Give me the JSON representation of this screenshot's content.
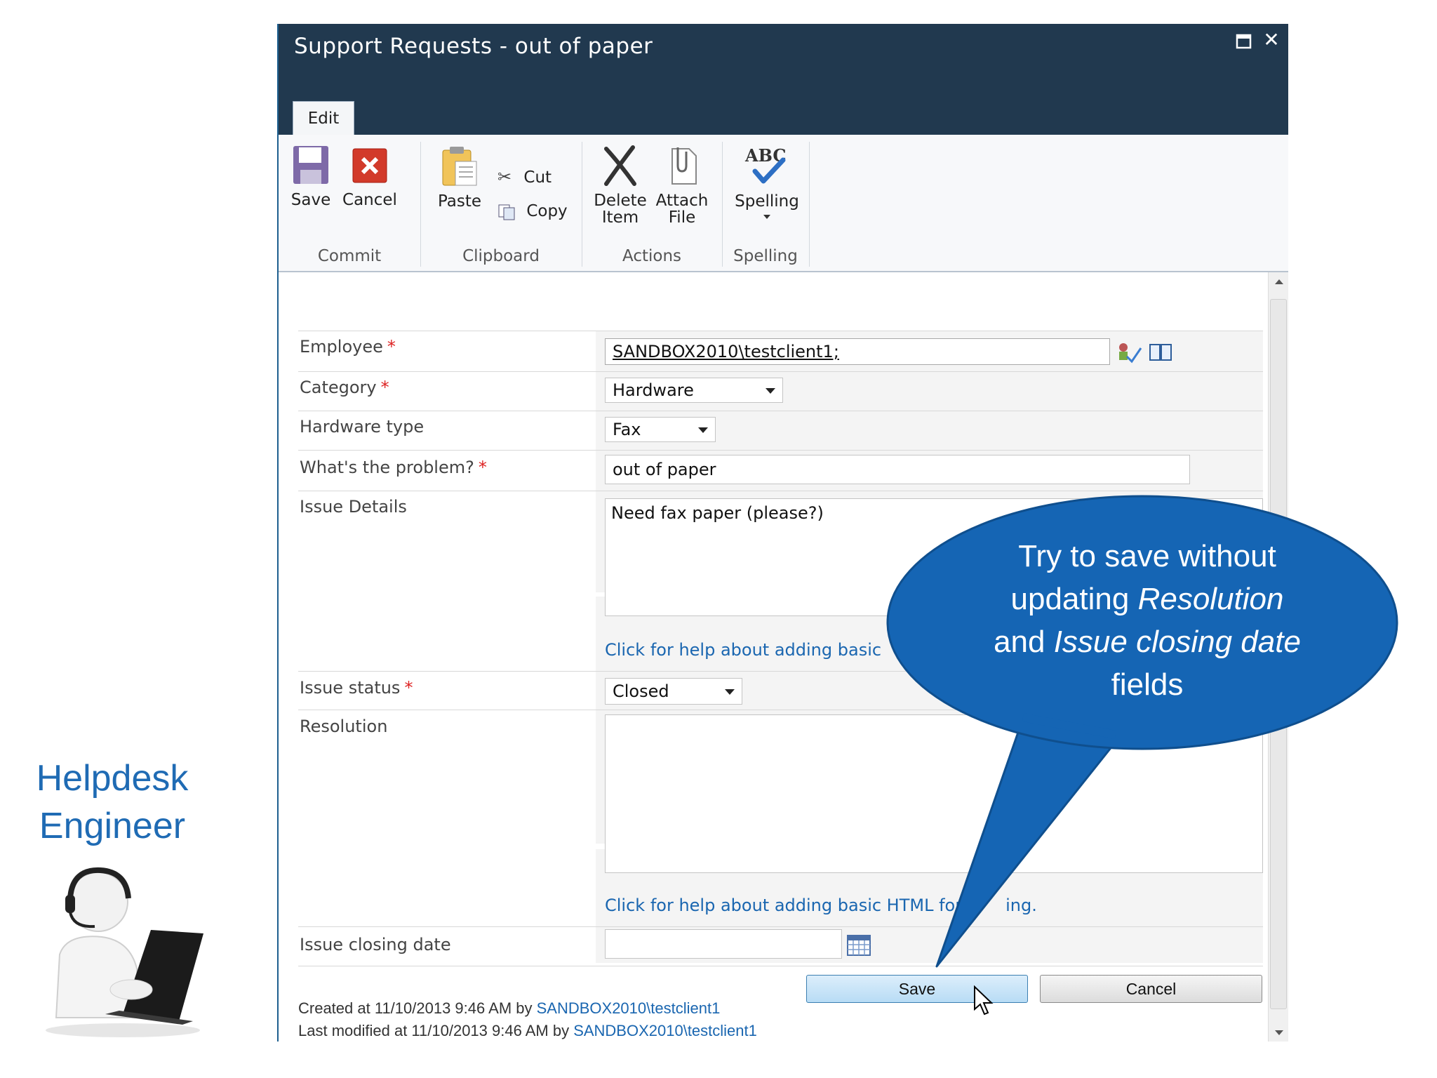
{
  "persona": {
    "title_line1": "Helpdesk",
    "title_line2": "Engineer"
  },
  "dialog": {
    "title": "Support Requests - out of paper",
    "tab": "Edit",
    "ribbon": {
      "save": "Save",
      "cancel": "Cancel",
      "paste": "Paste",
      "cut": "Cut",
      "copy": "Copy",
      "delete_line1": "Delete",
      "delete_line2": "Item",
      "attach_line1": "Attach",
      "attach_line2": "File",
      "spelling": "Spelling",
      "group_commit": "Commit",
      "group_clipboard": "Clipboard",
      "group_actions": "Actions",
      "group_spelling": "Spelling"
    }
  },
  "form": {
    "employee": {
      "label": "Employee",
      "value": "SANDBOX2010\\testclient1;"
    },
    "category": {
      "label": "Category",
      "value": "Hardware"
    },
    "hardware_type": {
      "label": "Hardware type",
      "value": "Fax"
    },
    "problem": {
      "label": "What's the problem?",
      "value": "out of paper"
    },
    "issue_details": {
      "label": "Issue Details",
      "value": "Need fax paper (please?)",
      "help": "Click for help about adding basic"
    },
    "issue_status": {
      "label": "Issue status",
      "value": "Closed"
    },
    "resolution": {
      "label": "Resolution",
      "value": "",
      "help": "Click for help about adding basic HTML for",
      "help_tail": "ing."
    },
    "issue_closing_date": {
      "label": "Issue closing date",
      "value": ""
    },
    "required_marker": "*"
  },
  "footer": {
    "created_prefix": "Created at 11/10/2013 9:46 AM by ",
    "created_by": "SANDBOX2010\\testclient1",
    "modified_prefix": "Last modified at 11/10/2013 9:46 AM by ",
    "modified_by": "SANDBOX2010\\testclient1",
    "save": "Save",
    "cancel": "Cancel"
  },
  "callout": {
    "line1": "Try to save without",
    "line2_a": "updating ",
    "line2_b": "Resolution",
    "line3_a": "and ",
    "line3_b": "Issue closing date",
    "line4": "fields"
  },
  "colors": {
    "titlebar": "#21394f",
    "callout": "#1565b4",
    "link": "#1a66b0",
    "required": "#dd2222"
  }
}
